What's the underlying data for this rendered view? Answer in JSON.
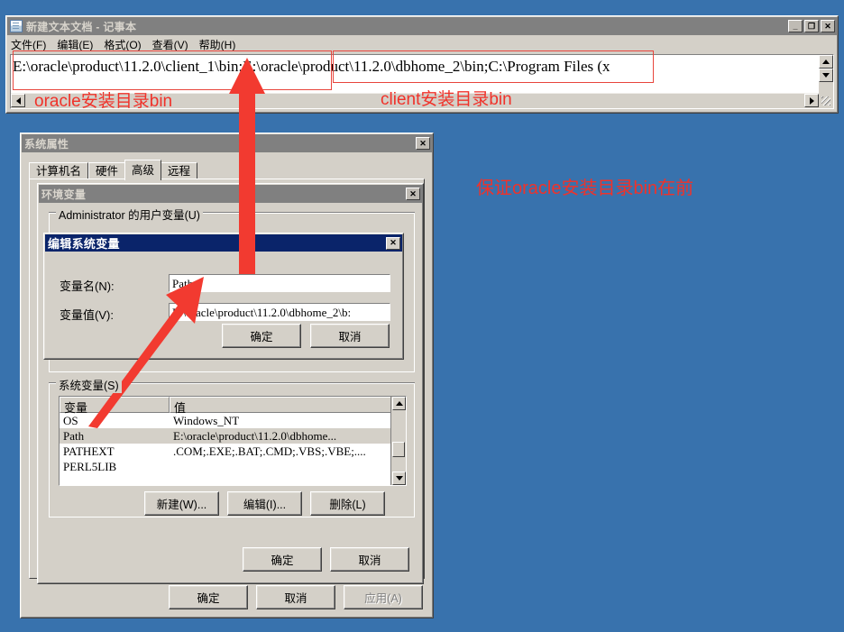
{
  "background_color": "#3872ad",
  "annotation_color": "#f0322a",
  "notepad": {
    "title": "新建文本文档 - 记事本",
    "icon": "notepad-document-icon",
    "menu": [
      "文件(F)",
      "编辑(E)",
      "格式(O)",
      "查看(V)",
      "帮助(H)"
    ],
    "content": "E:\\oracle\\product\\11.2.0\\client_1\\bin;E:\\oracle\\product\\11.2.0\\dbhome_2\\bin;C:\\Program Files (x",
    "window_controls": {
      "minimize": "_",
      "maximize": "❐",
      "close": "✕"
    }
  },
  "system_properties": {
    "title": "系统属性",
    "close_label": "✕",
    "tabs": [
      {
        "label": "计算机名",
        "selected": false
      },
      {
        "label": "硬件",
        "selected": false
      },
      {
        "label": "高级",
        "selected": true
      },
      {
        "label": "远程",
        "selected": false
      }
    ],
    "buttons": [
      {
        "label": "确定",
        "disabled": false
      },
      {
        "label": "取消",
        "disabled": false
      },
      {
        "label": "应用(A)",
        "disabled": true
      }
    ]
  },
  "environment_variables": {
    "title": "环境变量",
    "close_label": "✕",
    "user_group_label": "Administrator 的用户变量(U)",
    "system_group_label": "系统变量(S)",
    "columns": [
      "变量",
      "值"
    ],
    "rows": [
      {
        "name": "OS",
        "value": "Windows_NT",
        "selected": false
      },
      {
        "name": "Path",
        "value": "E:\\oracle\\product\\11.2.0\\dbhome...",
        "selected": true
      },
      {
        "name": "PATHEXT",
        "value": ".COM;.EXE;.BAT;.CMD;.VBS;.VBE;....",
        "selected": false
      },
      {
        "name": "PERL5LIB",
        "value": "",
        "selected": false
      }
    ],
    "list_buttons": [
      {
        "label": "新建(W)..."
      },
      {
        "label": "编辑(I)..."
      },
      {
        "label": "删除(L)"
      }
    ],
    "dialog_buttons": [
      {
        "label": "确定"
      },
      {
        "label": "取消"
      }
    ]
  },
  "edit_system_variable": {
    "title": "编辑系统变量",
    "close_label": "✕",
    "name_label": "变量名(N):",
    "name_value": "Path",
    "value_label": "变量值(V):",
    "value_value": "E:\\oracle\\product\\11.2.0\\dbhome_2\\b:",
    "buttons": [
      {
        "label": "确定"
      },
      {
        "label": "取消"
      }
    ]
  },
  "annotations": {
    "oracle_bin_label": "oracle安装目录bin",
    "client_bin_label": "client安装目录bin",
    "note_label": "保证oracle安装目录bin在前"
  }
}
